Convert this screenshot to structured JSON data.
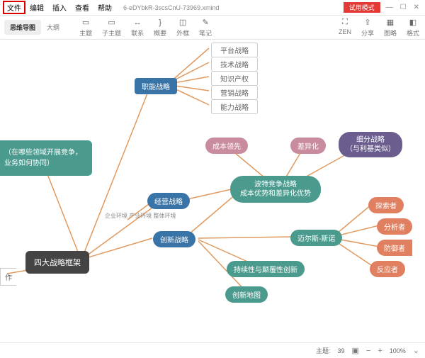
{
  "menu": {
    "file": "文件",
    "edit": "编辑",
    "insert": "插入",
    "view": "查看",
    "help": "帮助"
  },
  "filename": "6-eDYbkR-3scsCnU-73969.xmind",
  "trial": "试用模式",
  "win": {
    "min": "—",
    "max": "☐",
    "close": "✕"
  },
  "tabs": {
    "mindmap": "思维导图",
    "outline": "大纲"
  },
  "tools": {
    "topic": "主题",
    "subtopic": "子主题",
    "relation": "联系",
    "summary": "概要",
    "boundary": "外框",
    "note": "笔记"
  },
  "rtools": {
    "zen": "ZEN",
    "share": "分享",
    "map": "图略",
    "format": "格式"
  },
  "nodes": {
    "root": "四大战略框架",
    "context": "（在哪些领域开展竞争，业务如何协同）",
    "func": "职能战略",
    "biz": "经营战略",
    "innov": "创新战略",
    "porter": "波特竞争战略\n成本优势和差异化优势",
    "cost": "成本领先",
    "diff": "差异化",
    "seg": "细分战略\n（与利基类似）",
    "miles": "迈尔斯-斯诺",
    "expl": "探索者",
    "anal": "分析者",
    "def": "防御者",
    "react": "反应者",
    "sustain": "持续性与颠覆性创新",
    "map": "创新地图",
    "plat": "平台战略",
    "tech": "技术战略",
    "ip": "知识产权",
    "mkt": "营销战略",
    "cap": "能力战略",
    "env": "企业环境\n产业环境\n整体环境",
    "op": "作"
  },
  "status": {
    "topics_label": "主题:",
    "topics": "39",
    "zoom": "100%"
  }
}
